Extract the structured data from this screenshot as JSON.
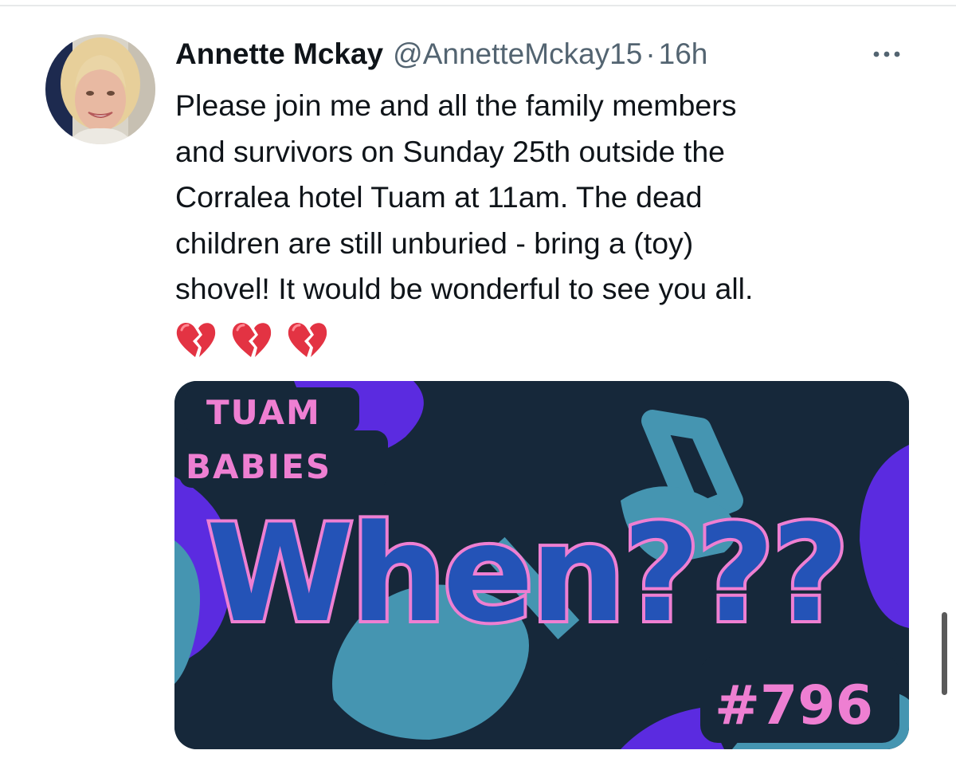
{
  "tweet": {
    "author_name": "Annette Mckay",
    "author_handle": "@AnnetteMckay15",
    "separator": "·",
    "timestamp": "16h",
    "text_lines": [
      "Please join me and all the family members",
      "and survivors on Sunday 25th outside the",
      "Corralea hotel Tuam at 11am. The dead",
      "children are still unburied - bring a (toy)",
      "shovel! It would be wonderful to see you all."
    ],
    "emojis": [
      "broken-heart",
      "broken-heart",
      "broken-heart"
    ]
  },
  "media": {
    "badge_line1": "TUAM",
    "badge_line2": "BABIES",
    "headline": "When???",
    "hashtag": "#796"
  },
  "icons": {
    "more": "more-horizontal-icon",
    "emoji": "broken-heart-icon"
  },
  "colors": {
    "text_primary": "#0f1419",
    "text_secondary": "#536471",
    "card_background": "#16283a",
    "card_shovel": "#4595b1",
    "card_purple": "#5b2be0",
    "card_pink": "#ee7fd2",
    "card_blue_text": "#2453b7",
    "heart_red": "#e33343"
  }
}
